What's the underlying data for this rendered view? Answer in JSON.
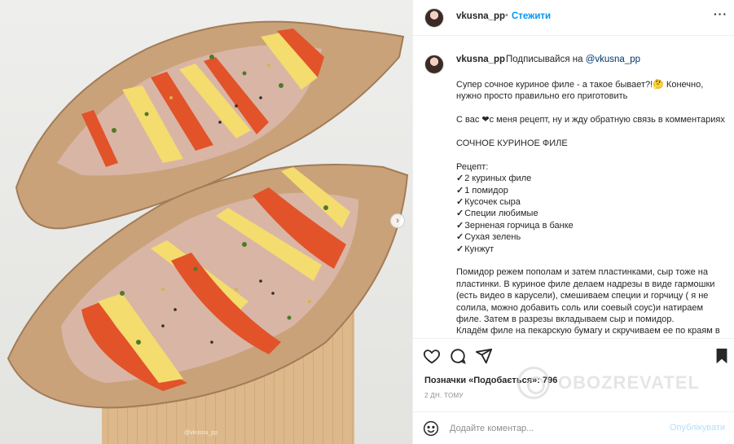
{
  "photo": {
    "alt_icons": [
      "chevron-right-icon"
    ],
    "carousel_next_glyph": "›",
    "credit": "@vkusna_pp"
  },
  "header": {
    "username": "vkusna_pp",
    "dot": "•",
    "follow_label": "Стежити",
    "more_glyph": "···"
  },
  "caption": {
    "username": "vkusna_pp",
    "subscribe_text": "Подписывайся на ",
    "mention": "@vkusna_pp",
    "intro": "Супер сочное куриное филе - а такое бывает?!🤔 Конечно, нужно просто правильно его приготовить",
    "share": "С вас ❤с меня рецепт, ну и жду обратную связь в комментариях",
    "recipe_title": "СОЧНОЕ КУРИНОЕ ФИЛЕ",
    "recipe_label": "Рецепт:",
    "check_glyph": "✓",
    "ingredients": [
      "2 куриных филе",
      "1 помидор",
      "Кусочек сыра",
      "Специи любимые",
      "Зерненая горчица в банке",
      "Сухая зелень",
      "Кунжут"
    ],
    "steps": "Помидор режем пополам и затем пластинками, сыр тоже на пластинки. В куриное филе делаем надрезы в виде гармошки (есть видео в карусели), смешиваем специи и горчицу ( я не солила, можно добавить соль или соевый соус)и натираем филе. Затем в разрезы вкладываем сыр и помидор.",
    "steps2": "Кладём филе на пекарскую бумагу и скручиваем ее по краям в"
  },
  "actions": {
    "likes": "Позначки «Подобається»: 796",
    "date": "2 ДН. ТОМУ"
  },
  "watermark": {
    "text": "OBOZREVATEL"
  },
  "comment": {
    "placeholder": "Додайте коментар...",
    "publish_label": "Опублікувати"
  },
  "colors": {
    "accent": "#0095f6",
    "mention": "#00376b",
    "publish_disabled": "#b2dffc",
    "text": "#262626",
    "muted": "#8e8e8e",
    "parchment": "#c9a27a",
    "tomato": "#e2532a",
    "cheese": "#f4dc6e",
    "board": "#dcb88b"
  }
}
